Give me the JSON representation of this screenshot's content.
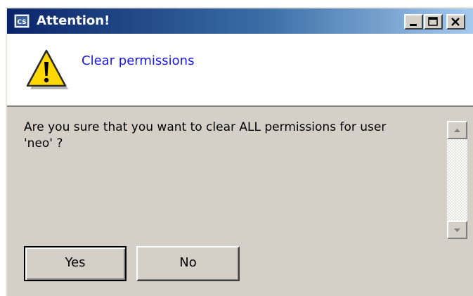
{
  "window": {
    "title": "Attention!",
    "app_icon": "app-cs-icon",
    "controls": {
      "minimize_icon": "minimize-icon",
      "maximize_icon": "maximize-icon",
      "close_icon": "close-icon"
    }
  },
  "header": {
    "icon": "warning-icon",
    "title": "Clear permissions"
  },
  "message": {
    "text": "Are you sure that you want to clear ALL permissions for user\n'neo' ?"
  },
  "scrollbar": {
    "up_icon": "scroll-up-arrow-icon",
    "down_icon": "scroll-down-arrow-icon"
  },
  "buttons": {
    "yes_label": "Yes",
    "no_label": "No",
    "default": "Yes"
  },
  "colors": {
    "titlebar_start": "#0a246a",
    "titlebar_end": "#a6caf0",
    "header_title": "#1818e0",
    "dialog_face": "#d4d0c8",
    "warning_fill": "#ffd800"
  }
}
